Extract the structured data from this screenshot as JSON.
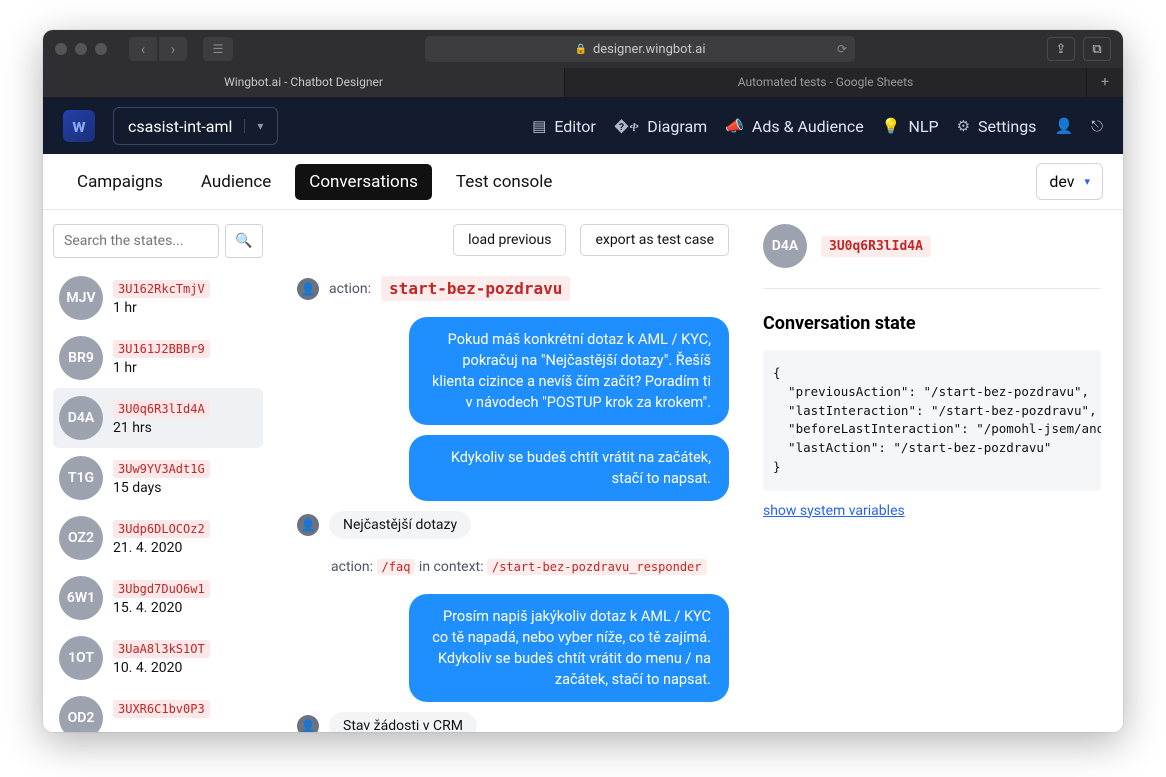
{
  "browser": {
    "url_host": "designer.wingbot.ai",
    "tabs": [
      {
        "title": "Wingbot.ai - Chatbot Designer",
        "active": true
      },
      {
        "title": "Automated tests - Google Sheets",
        "active": false
      }
    ]
  },
  "app": {
    "workspace": "csasist-int-aml",
    "nav": {
      "editor": "Editor",
      "diagram": "Diagram",
      "ads": "Ads & Audience",
      "nlp": "NLP",
      "settings": "Settings"
    }
  },
  "subtabs": {
    "campaigns": "Campaigns",
    "audience": "Audience",
    "conversations": "Conversations",
    "test_console": "Test console",
    "env": "dev"
  },
  "sidebar": {
    "search_placeholder": "Search the states...",
    "items": [
      {
        "initials": "MJV",
        "id": "3U162RkcTmjV",
        "time": "1 hr"
      },
      {
        "initials": "BR9",
        "id": "3U161J2BBBr9",
        "time": "1 hr"
      },
      {
        "initials": "D4A",
        "id": "3U0q6R3lId4A",
        "time": "21 hrs"
      },
      {
        "initials": "T1G",
        "id": "3Uw9YV3Adt1G",
        "time": "15 days"
      },
      {
        "initials": "OZ2",
        "id": "3Udp6DLOCOz2",
        "time": "21. 4. 2020"
      },
      {
        "initials": "6W1",
        "id": "3Ubgd7DuO6w1",
        "time": "15. 4. 2020"
      },
      {
        "initials": "1OT",
        "id": "3UaA8l3kS1OT",
        "time": "10. 4. 2020"
      },
      {
        "initials": "OD2",
        "id": "3UXR6C1bv0P3",
        "time": ""
      }
    ]
  },
  "chat": {
    "load_previous": "load previous",
    "export": "export as test case",
    "action_label": "action:",
    "in_context_label": "in context:",
    "start_action": "start-bez-pozdravu",
    "msg1": "Pokud máš konkrétní dotaz k AML / KYC, pokračuj na \"Nejčastější dotazy\". Řešíš klienta cizince a nevíš čím začít? Poradím ti v návodech \"POSTUP krok za krokem\".",
    "msg2": "Kdykoliv se budeš chtít vrátit na začátek, stačí to napsat.",
    "chip1": "Nejčastější dotazy",
    "action2": "/faq",
    "context2": "/start-bez-pozdravu_responder",
    "msg3": "Prosím napiš jakýkoliv dotaz k AML / KYC co tě napadá, nebo vyber níže, co tě zajímá. Kdykoliv se budeš chtít vrátit do menu / na začátek, stačí to napsat.",
    "chip2": "Stav žádosti v CRM"
  },
  "state": {
    "id": "3U0q6R3lId4A",
    "initials": "D4A",
    "title": "Conversation state",
    "json_text": "{\n  \"previousAction\": \"/start-bez-pozdravu\",\n  \"lastInteraction\": \"/start-bez-pozdravu\",\n  \"beforeLastInteraction\": \"/pomohl-jsem/ano-pomohl-\n  \"lastAction\": \"/start-bez-pozdravu\"\n}",
    "show_vars": "show system variables"
  }
}
